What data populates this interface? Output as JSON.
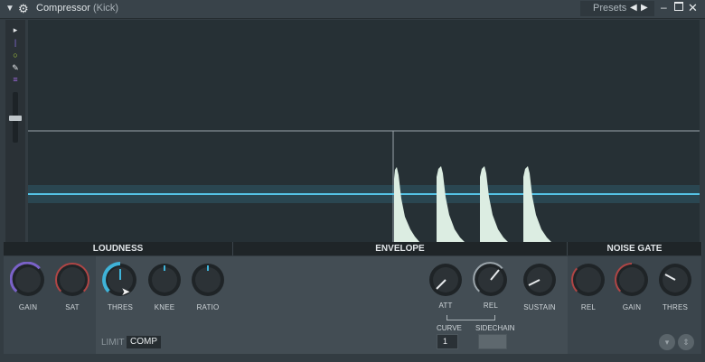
{
  "window": {
    "title": "Compressor",
    "subtitle": "(Kick)",
    "presets_label": "Presets"
  },
  "sections": {
    "loudness": "LOUDNESS",
    "envelope": "ENVELOPE",
    "noise_gate": "NOISE GATE"
  },
  "knobs": {
    "gain": "GAIN",
    "sat": "SAT",
    "thres": "THRES",
    "knee": "KNEE",
    "ratio": "RATIO",
    "att": "ATT",
    "rel": "REL",
    "sustain": "SUSTAIN",
    "gate_rel": "REL",
    "gate_gain": "GAIN",
    "gate_thres": "THRES"
  },
  "mode": {
    "limit": "LIMIT",
    "comp": "COMP"
  },
  "curve": {
    "label": "CURVE",
    "value": "1"
  },
  "sidechain": {
    "label": "SIDECHAIN"
  },
  "colors": {
    "accent_blue": "#3fb3d8",
    "gain_ring": "#7a62c8",
    "sat_ring": "#b04545",
    "envelope_fill": "#ddefe4"
  }
}
